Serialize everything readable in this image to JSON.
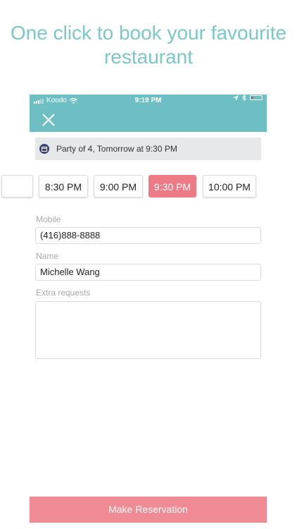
{
  "headline": {
    "line1": "One click to book your favourite",
    "line2": "restaurant"
  },
  "status_bar": {
    "carrier": "Koodo",
    "time": "9:19 PM",
    "icons": [
      "signal-icon",
      "wifi-icon",
      "location-arrow-icon",
      "bluetooth-icon",
      "battery-icon"
    ],
    "battery_level": 0.15,
    "battery_color": "#e5504b"
  },
  "header": {
    "close_icon": "close-icon",
    "background": "#6dbfc3"
  },
  "summary": {
    "icon": "calendar-icon",
    "text": "Party of 4, Tomorrow at 9:30 PM"
  },
  "time_slots": {
    "items": [
      {
        "label": ""
      },
      {
        "label": "8:30 PM"
      },
      {
        "label": "9:00 PM"
      },
      {
        "label": "9:30 PM",
        "selected": true
      },
      {
        "label": "10:00 PM"
      }
    ],
    "selected_color": "#ec7b86"
  },
  "form": {
    "mobile_label": "Mobile",
    "mobile_value": "(416)888-8888",
    "name_label": "Name",
    "name_value": "Michelle Wang",
    "extra_label": "Extra requests",
    "extra_value": ""
  },
  "actions": {
    "reserve_label": "Make Reservation",
    "reserve_color": "#f08a94"
  }
}
